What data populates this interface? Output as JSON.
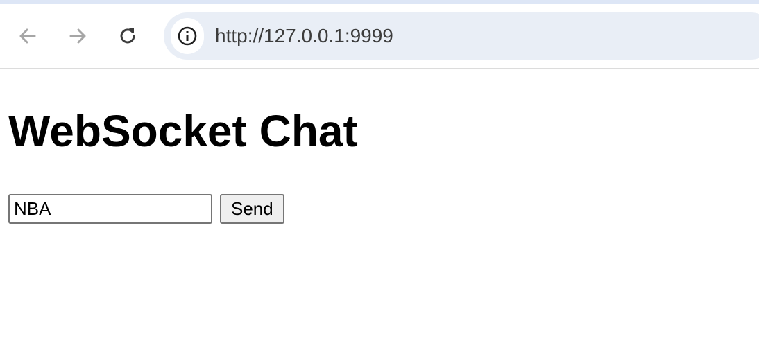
{
  "browser": {
    "url": "http://127.0.0.1:9999",
    "icons": {
      "back": "back-arrow-icon",
      "forward": "forward-arrow-icon",
      "reload": "reload-icon",
      "site_info": "info-icon"
    },
    "colors": {
      "top_strip": "#dde6f6",
      "omnibox": "#e9eef6"
    }
  },
  "page": {
    "title": "WebSocket Chat",
    "input_value": "NBA",
    "send_label": "Send"
  }
}
